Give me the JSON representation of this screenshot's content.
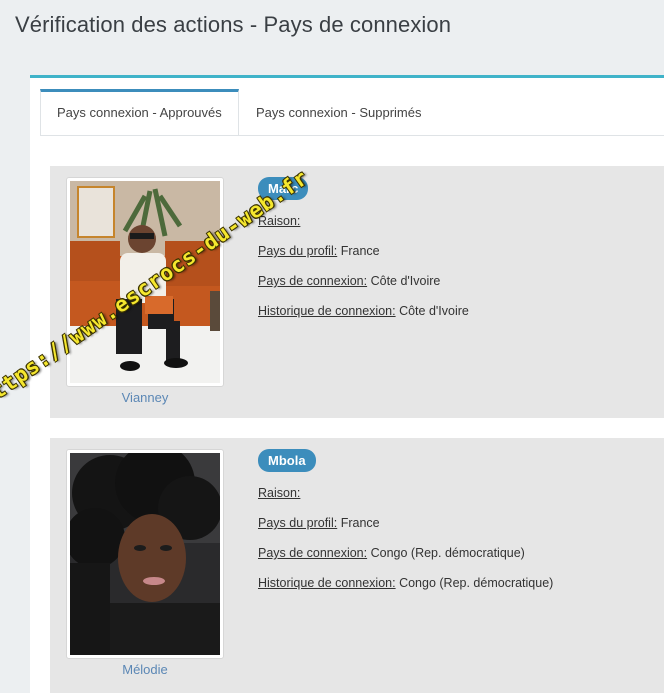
{
  "page": {
    "title": "Vérification des actions - Pays de connexion"
  },
  "tabs": [
    {
      "label": "Pays connexion - Approuvés",
      "active": true
    },
    {
      "label": "Pays connexion - Supprimés",
      "active": false
    }
  ],
  "entries": [
    {
      "name": "Marc",
      "photo_caption": "Vianney",
      "raison_label": "Raison:",
      "raison_value": "",
      "profil_label": "Pays du profil:",
      "profil_value": "France",
      "connexion_label": "Pays de connexion:",
      "connexion_value": "Côte d'Ivoire",
      "historique_label": "Historique de connexion:",
      "historique_value": "Côte d'Ivoire"
    },
    {
      "name": "Mbola",
      "photo_caption": "Mélodie",
      "raison_label": "Raison:",
      "raison_value": "",
      "profil_label": "Pays du profil:",
      "profil_value": "France",
      "connexion_label": "Pays de connexion:",
      "connexion_value": "Congo (Rep. démocratique)",
      "historique_label": "Historique de connexion:",
      "historique_value": "Congo (Rep. démocratique)"
    }
  ],
  "watermark": "https://www.escrocs-du-web.fr",
  "colors": {
    "accent": "#3c8dbc",
    "box_border": "#3fb3c9",
    "badge": "#3c8dbc",
    "card_bg": "#e6e6e6",
    "watermark": "#f5e72e"
  }
}
